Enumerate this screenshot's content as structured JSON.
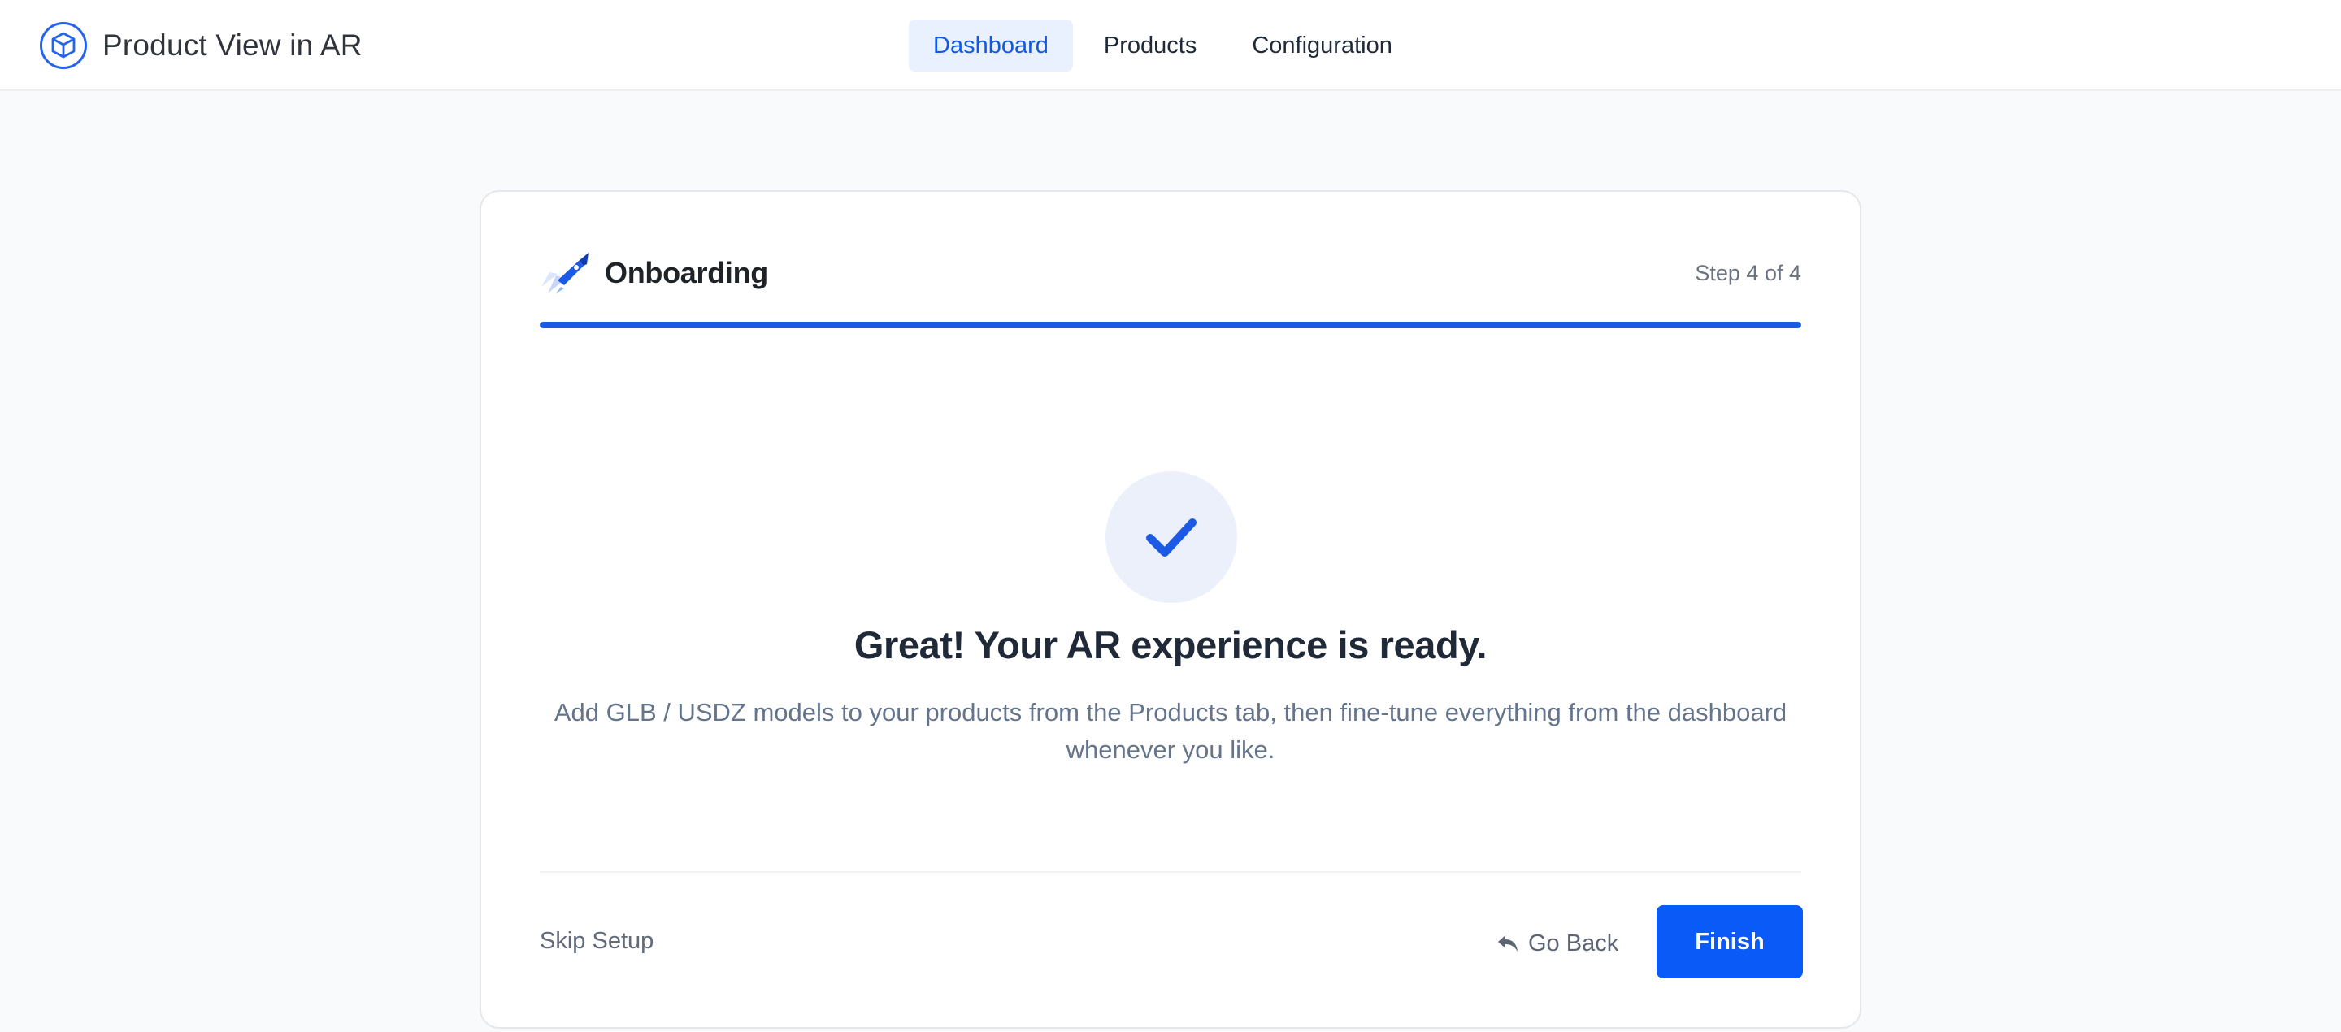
{
  "app": {
    "name": "Product View in AR",
    "logo_icon": "cube-icon",
    "accent_color": "#1c5ae6"
  },
  "nav": {
    "tabs": [
      {
        "label": "Dashboard",
        "active": true
      },
      {
        "label": "Products",
        "active": false
      },
      {
        "label": "Configuration",
        "active": false
      }
    ]
  },
  "onboarding": {
    "icon": "rocket-icon",
    "title": "Onboarding",
    "step_label": "Step 4 of 4",
    "progress": 1.0,
    "status_icon": "checkmark-icon",
    "headline": "Great! Your AR experience is ready.",
    "description": "Add GLB / USDZ models to your products from the Products tab, then fine-tune everything from the dashboard whenever you like.",
    "skip_label": "Skip Setup",
    "back_label": "Go Back",
    "back_icon": "reply-arrow-icon",
    "finish_label": "Finish",
    "finish_color": "#0a5af7"
  }
}
